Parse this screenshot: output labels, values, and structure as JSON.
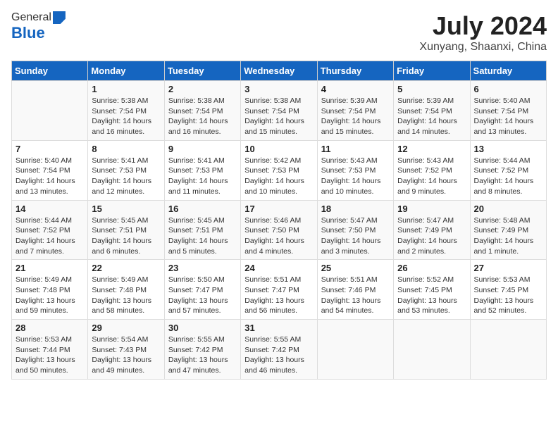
{
  "header": {
    "logo_general": "General",
    "logo_blue": "Blue",
    "title": "July 2024",
    "subtitle": "Xunyang, Shaanxi, China"
  },
  "days_of_week": [
    "Sunday",
    "Monday",
    "Tuesday",
    "Wednesday",
    "Thursday",
    "Friday",
    "Saturday"
  ],
  "weeks": [
    [
      {
        "day": "",
        "info": ""
      },
      {
        "day": "1",
        "info": "Sunrise: 5:38 AM\nSunset: 7:54 PM\nDaylight: 14 hours\nand 16 minutes."
      },
      {
        "day": "2",
        "info": "Sunrise: 5:38 AM\nSunset: 7:54 PM\nDaylight: 14 hours\nand 16 minutes."
      },
      {
        "day": "3",
        "info": "Sunrise: 5:38 AM\nSunset: 7:54 PM\nDaylight: 14 hours\nand 15 minutes."
      },
      {
        "day": "4",
        "info": "Sunrise: 5:39 AM\nSunset: 7:54 PM\nDaylight: 14 hours\nand 15 minutes."
      },
      {
        "day": "5",
        "info": "Sunrise: 5:39 AM\nSunset: 7:54 PM\nDaylight: 14 hours\nand 14 minutes."
      },
      {
        "day": "6",
        "info": "Sunrise: 5:40 AM\nSunset: 7:54 PM\nDaylight: 14 hours\nand 13 minutes."
      }
    ],
    [
      {
        "day": "7",
        "info": "Sunrise: 5:40 AM\nSunset: 7:54 PM\nDaylight: 14 hours\nand 13 minutes."
      },
      {
        "day": "8",
        "info": "Sunrise: 5:41 AM\nSunset: 7:53 PM\nDaylight: 14 hours\nand 12 minutes."
      },
      {
        "day": "9",
        "info": "Sunrise: 5:41 AM\nSunset: 7:53 PM\nDaylight: 14 hours\nand 11 minutes."
      },
      {
        "day": "10",
        "info": "Sunrise: 5:42 AM\nSunset: 7:53 PM\nDaylight: 14 hours\nand 10 minutes."
      },
      {
        "day": "11",
        "info": "Sunrise: 5:43 AM\nSunset: 7:53 PM\nDaylight: 14 hours\nand 10 minutes."
      },
      {
        "day": "12",
        "info": "Sunrise: 5:43 AM\nSunset: 7:52 PM\nDaylight: 14 hours\nand 9 minutes."
      },
      {
        "day": "13",
        "info": "Sunrise: 5:44 AM\nSunset: 7:52 PM\nDaylight: 14 hours\nand 8 minutes."
      }
    ],
    [
      {
        "day": "14",
        "info": "Sunrise: 5:44 AM\nSunset: 7:52 PM\nDaylight: 14 hours\nand 7 minutes."
      },
      {
        "day": "15",
        "info": "Sunrise: 5:45 AM\nSunset: 7:51 PM\nDaylight: 14 hours\nand 6 minutes."
      },
      {
        "day": "16",
        "info": "Sunrise: 5:45 AM\nSunset: 7:51 PM\nDaylight: 14 hours\nand 5 minutes."
      },
      {
        "day": "17",
        "info": "Sunrise: 5:46 AM\nSunset: 7:50 PM\nDaylight: 14 hours\nand 4 minutes."
      },
      {
        "day": "18",
        "info": "Sunrise: 5:47 AM\nSunset: 7:50 PM\nDaylight: 14 hours\nand 3 minutes."
      },
      {
        "day": "19",
        "info": "Sunrise: 5:47 AM\nSunset: 7:49 PM\nDaylight: 14 hours\nand 2 minutes."
      },
      {
        "day": "20",
        "info": "Sunrise: 5:48 AM\nSunset: 7:49 PM\nDaylight: 14 hours\nand 1 minute."
      }
    ],
    [
      {
        "day": "21",
        "info": "Sunrise: 5:49 AM\nSunset: 7:48 PM\nDaylight: 13 hours\nand 59 minutes."
      },
      {
        "day": "22",
        "info": "Sunrise: 5:49 AM\nSunset: 7:48 PM\nDaylight: 13 hours\nand 58 minutes."
      },
      {
        "day": "23",
        "info": "Sunrise: 5:50 AM\nSunset: 7:47 PM\nDaylight: 13 hours\nand 57 minutes."
      },
      {
        "day": "24",
        "info": "Sunrise: 5:51 AM\nSunset: 7:47 PM\nDaylight: 13 hours\nand 56 minutes."
      },
      {
        "day": "25",
        "info": "Sunrise: 5:51 AM\nSunset: 7:46 PM\nDaylight: 13 hours\nand 54 minutes."
      },
      {
        "day": "26",
        "info": "Sunrise: 5:52 AM\nSunset: 7:45 PM\nDaylight: 13 hours\nand 53 minutes."
      },
      {
        "day": "27",
        "info": "Sunrise: 5:53 AM\nSunset: 7:45 PM\nDaylight: 13 hours\nand 52 minutes."
      }
    ],
    [
      {
        "day": "28",
        "info": "Sunrise: 5:53 AM\nSunset: 7:44 PM\nDaylight: 13 hours\nand 50 minutes."
      },
      {
        "day": "29",
        "info": "Sunrise: 5:54 AM\nSunset: 7:43 PM\nDaylight: 13 hours\nand 49 minutes."
      },
      {
        "day": "30",
        "info": "Sunrise: 5:55 AM\nSunset: 7:42 PM\nDaylight: 13 hours\nand 47 minutes."
      },
      {
        "day": "31",
        "info": "Sunrise: 5:55 AM\nSunset: 7:42 PM\nDaylight: 13 hours\nand 46 minutes."
      },
      {
        "day": "",
        "info": ""
      },
      {
        "day": "",
        "info": ""
      },
      {
        "day": "",
        "info": ""
      }
    ]
  ]
}
